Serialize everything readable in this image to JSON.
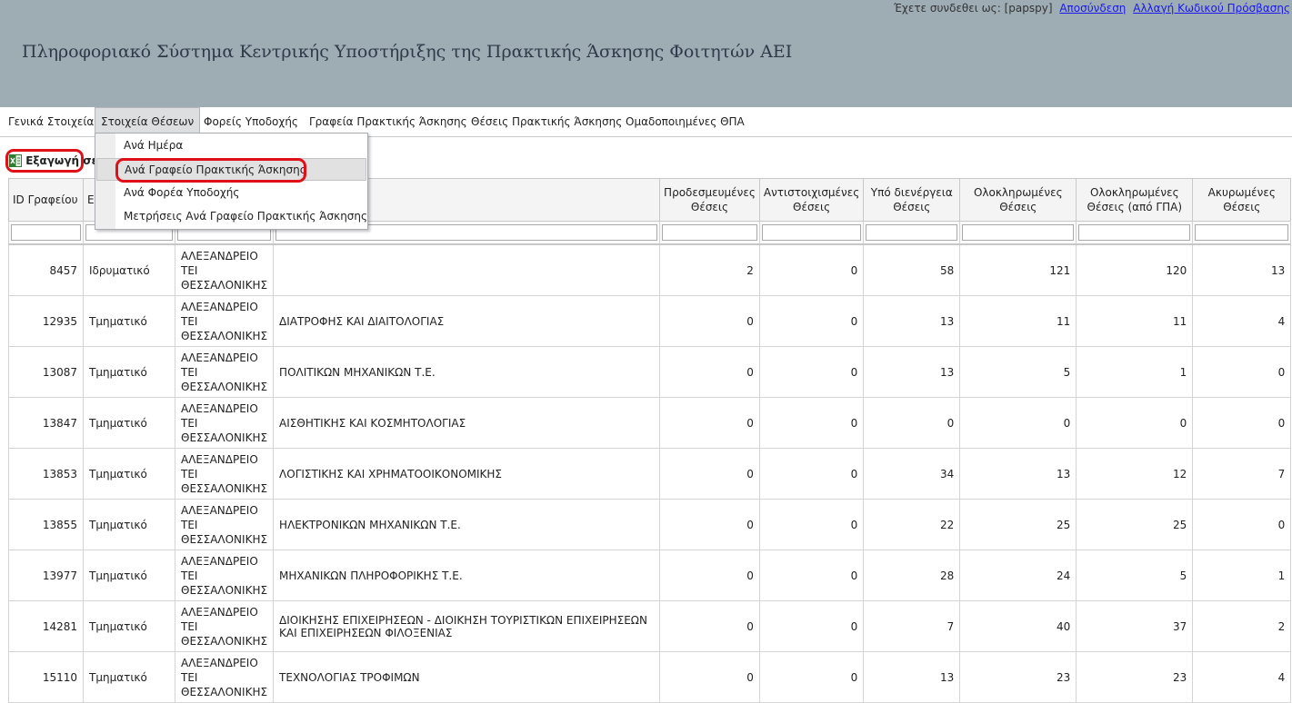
{
  "header": {
    "logged_in_as": "Έχετε συνδεθει ως: [papspy]",
    "logout": "Αποσύνδεση",
    "change_password": "Αλλαγή Κωδικού Πρόσβασης",
    "title": "Πληροφοριακό Σύστημα Κεντρικής Υποστήριξης της Πρακτικής Άσκησης Φοιτητών ΑΕΙ"
  },
  "menu": {
    "items": [
      {
        "label": "Γενικά Στοιχεία"
      },
      {
        "label": "Στοιχεία Θέσεων"
      },
      {
        "label": "Φορείς Υποδοχής"
      },
      {
        "label": "Γραφεία Πρακτικής Άσκησης"
      },
      {
        "label": "Θέσεις Πρακτικής Άσκησης"
      },
      {
        "label": "Ομαδοποιημένες ΘΠΑ"
      }
    ],
    "dropdown": [
      {
        "label": "Ανά Ημέρα"
      },
      {
        "label": "Ανά Γραφείο Πρακτικής Άσκησης"
      },
      {
        "label": "Ανά Φορέα Υποδοχής"
      },
      {
        "label": "Μετρήσεις Ανά Γραφείο Πρακτικής Άσκησης"
      }
    ]
  },
  "export": {
    "label": "Εξαγωγή σε"
  },
  "table": {
    "columns": [
      "ID Γραφείου",
      "Ε",
      "",
      "",
      "Προδεσμευμένες Θέσεις",
      "Αντιστοιχισμένες Θέσεις",
      "Υπό διενέργεια Θέσεις",
      "Ολοκληρωμένες Θέσεις",
      "Ολοκληρωμένες Θέσεις (από ΓΠΑ)",
      "Ακυρωμένες Θέσεις"
    ],
    "rows": [
      [
        "8457",
        "Ιδρυματικό",
        "ΑΛΕΞΑΝΔΡΕΙΟ ΤΕΙ ΘΕΣΣΑΛΟΝΙΚΗΣ",
        "",
        "2",
        "0",
        "58",
        "121",
        "120",
        "13"
      ],
      [
        "12935",
        "Τμηματικό",
        "ΑΛΕΞΑΝΔΡΕΙΟ ΤΕΙ ΘΕΣΣΑΛΟΝΙΚΗΣ",
        "ΔΙΑΤΡΟΦΗΣ ΚΑΙ ΔΙΑΙΤΟΛΟΓΙΑΣ",
        "0",
        "0",
        "13",
        "11",
        "11",
        "4"
      ],
      [
        "13087",
        "Τμηματικό",
        "ΑΛΕΞΑΝΔΡΕΙΟ ΤΕΙ ΘΕΣΣΑΛΟΝΙΚΗΣ",
        "ΠΟΛΙΤΙΚΩΝ ΜΗΧΑΝΙΚΩΝ Τ.Ε.",
        "0",
        "0",
        "13",
        "5",
        "1",
        "0"
      ],
      [
        "13847",
        "Τμηματικό",
        "ΑΛΕΞΑΝΔΡΕΙΟ ΤΕΙ ΘΕΣΣΑΛΟΝΙΚΗΣ",
        "ΑΙΣΘΗΤΙΚΗΣ ΚΑΙ ΚΟΣΜΗΤΟΛΟΓΙΑΣ",
        "0",
        "0",
        "0",
        "0",
        "0",
        "0"
      ],
      [
        "13853",
        "Τμηματικό",
        "ΑΛΕΞΑΝΔΡΕΙΟ ΤΕΙ ΘΕΣΣΑΛΟΝΙΚΗΣ",
        "ΛΟΓΙΣΤΙΚΗΣ ΚΑΙ ΧΡΗΜΑΤΟΟΙΚΟΝΟΜΙΚΗΣ",
        "0",
        "0",
        "34",
        "13",
        "12",
        "7"
      ],
      [
        "13855",
        "Τμηματικό",
        "ΑΛΕΞΑΝΔΡΕΙΟ ΤΕΙ ΘΕΣΣΑΛΟΝΙΚΗΣ",
        "ΗΛΕΚΤΡΟΝΙΚΩΝ ΜΗΧΑΝΙΚΩΝ Τ.Ε.",
        "0",
        "0",
        "22",
        "25",
        "25",
        "0"
      ],
      [
        "13977",
        "Τμηματικό",
        "ΑΛΕΞΑΝΔΡΕΙΟ ΤΕΙ ΘΕΣΣΑΛΟΝΙΚΗΣ",
        "ΜΗΧΑΝΙΚΩΝ ΠΛΗΡΟΦΟΡΙΚΗΣ Τ.Ε.",
        "0",
        "0",
        "28",
        "24",
        "5",
        "1"
      ],
      [
        "14281",
        "Τμηματικό",
        "ΑΛΕΞΑΝΔΡΕΙΟ ΤΕΙ ΘΕΣΣΑΛΟΝΙΚΗΣ",
        "ΔΙΟΙΚΗΣΗΣ ΕΠΙΧΕΙΡΗΣΕΩΝ - ΔΙΟΙΚΗΣΗ ΤΟΥΡΙΣΤΙΚΩΝ ΕΠΙΧΕΙΡΗΣΕΩΝ ΚΑΙ ΕΠΙΧΕΙΡΗΣΕΩΝ ΦΙΛΟΞΕΝΙΑΣ",
        "0",
        "0",
        "7",
        "40",
        "37",
        "2"
      ],
      [
        "15110",
        "Τμηματικό",
        "ΑΛΕΞΑΝΔΡΕΙΟ ΤΕΙ ΘΕΣΣΑΛΟΝΙΚΗΣ",
        "ΤΕΧΝΟΛΟΓΙΑΣ ΤΡΟΦΙΜΩΝ",
        "0",
        "0",
        "13",
        "23",
        "23",
        "4"
      ]
    ]
  }
}
